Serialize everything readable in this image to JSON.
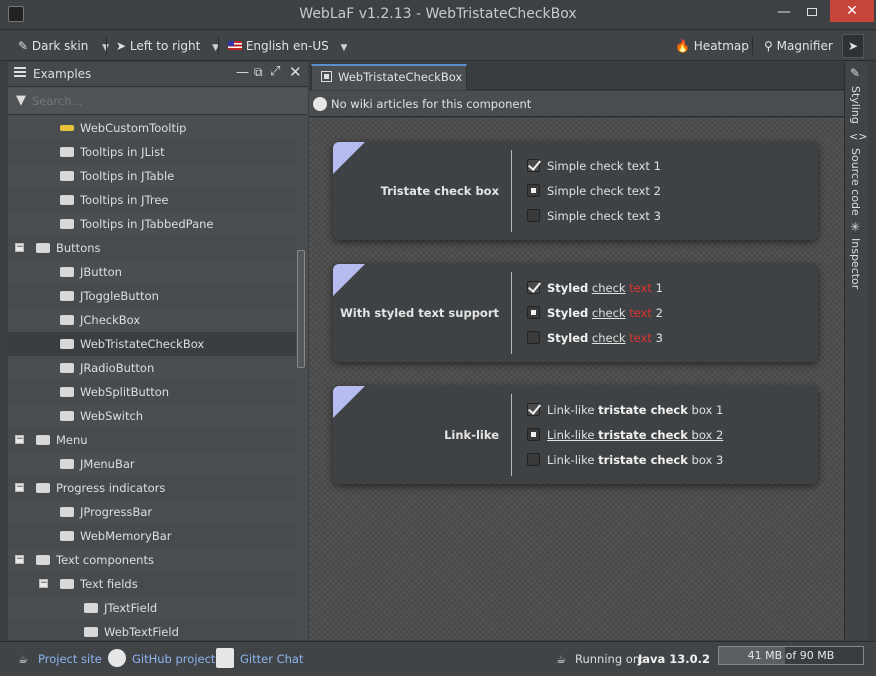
{
  "window": {
    "title": "WebLaF v1.2.13 - WebTristateCheckBox"
  },
  "toolbar": {
    "skin_label": "Dark skin",
    "orientation_label": "Left to right",
    "language_label": "English",
    "locale_label": "en-US",
    "heatmap_label": "Heatmap",
    "magnifier_label": "Magnifier"
  },
  "examples_panel": {
    "title": "Examples",
    "search_placeholder": "Search...",
    "tree": [
      {
        "label": "WebCustomTooltip",
        "icon": "tooltip-icon"
      },
      {
        "label": "Tooltips in JList",
        "icon": "list-icon"
      },
      {
        "label": "Tooltips in JTable",
        "icon": "table-icon"
      },
      {
        "label": "Tooltips in JTree",
        "icon": "tree-icon"
      },
      {
        "label": "Tooltips in JTabbedPane",
        "icon": "tabbed-pane-icon"
      },
      {
        "label": "Buttons",
        "icon": "buttons-icon"
      },
      {
        "label": "JButton",
        "icon": "button-icon"
      },
      {
        "label": "JToggleButton",
        "icon": "toggle-button-icon"
      },
      {
        "label": "JCheckBox",
        "icon": "checkbox-icon"
      },
      {
        "label": "WebTristateCheckBox",
        "icon": "tristate-checkbox-icon"
      },
      {
        "label": "JRadioButton",
        "icon": "radio-button-icon"
      },
      {
        "label": "WebSplitButton",
        "icon": "split-button-icon"
      },
      {
        "label": "WebSwitch",
        "icon": "switch-icon"
      },
      {
        "label": "Menu",
        "icon": "menu-icon"
      },
      {
        "label": "JMenuBar",
        "icon": "menubar-icon"
      },
      {
        "label": "Progress indicators",
        "icon": "progress-icon"
      },
      {
        "label": "JProgressBar",
        "icon": "progressbar-icon"
      },
      {
        "label": "WebMemoryBar",
        "icon": "memorybar-icon"
      },
      {
        "label": "Text components",
        "icon": "text-icon"
      },
      {
        "label": "Text fields",
        "icon": "textfield-group-icon"
      },
      {
        "label": "JTextField",
        "icon": "textfield-icon"
      },
      {
        "label": "WebTextField",
        "icon": "textfield-icon"
      }
    ]
  },
  "tab": {
    "label": "WebTristateCheckBox"
  },
  "wiki": {
    "text": "No wiki articles for this component"
  },
  "side_tabs": {
    "styling": "Styling",
    "source_code": "Source code",
    "inspector": "Inspector"
  },
  "cards": [
    {
      "title": "Tristate check box",
      "items": [
        {
          "state": "checked",
          "text": "Simple check text 1"
        },
        {
          "state": "mixed",
          "text": "Simple check text 2"
        },
        {
          "state": "unchecked",
          "text": "Simple check text 3"
        }
      ]
    },
    {
      "title": "With styled text support",
      "items": [
        {
          "state": "checked",
          "bold": "Styled",
          "link": "check",
          "red": "text",
          "num": "1"
        },
        {
          "state": "mixed",
          "bold": "Styled",
          "link": "check",
          "red": "text",
          "num": "2"
        },
        {
          "state": "unchecked",
          "bold": "Styled",
          "link": "check",
          "red": "text",
          "num": "3"
        }
      ]
    },
    {
      "title": "Link-like",
      "items": [
        {
          "state": "checked",
          "pre": "Link-like",
          "strong": "tristate check",
          "post": "box 1"
        },
        {
          "state": "mixed",
          "pre": "Link-like",
          "strong": "tristate check",
          "post": "box 2"
        },
        {
          "state": "unchecked",
          "pre": "Link-like",
          "strong": "tristate check",
          "post": "box 3"
        }
      ]
    }
  ],
  "status": {
    "project_site": "Project site",
    "github": "GitHub project",
    "gitter": "Gitter Chat",
    "running_on": "Running on:",
    "java": "Java 13.0.2",
    "memory": "41 MB of 90 MB",
    "memory_used_fraction": 0.455
  }
}
